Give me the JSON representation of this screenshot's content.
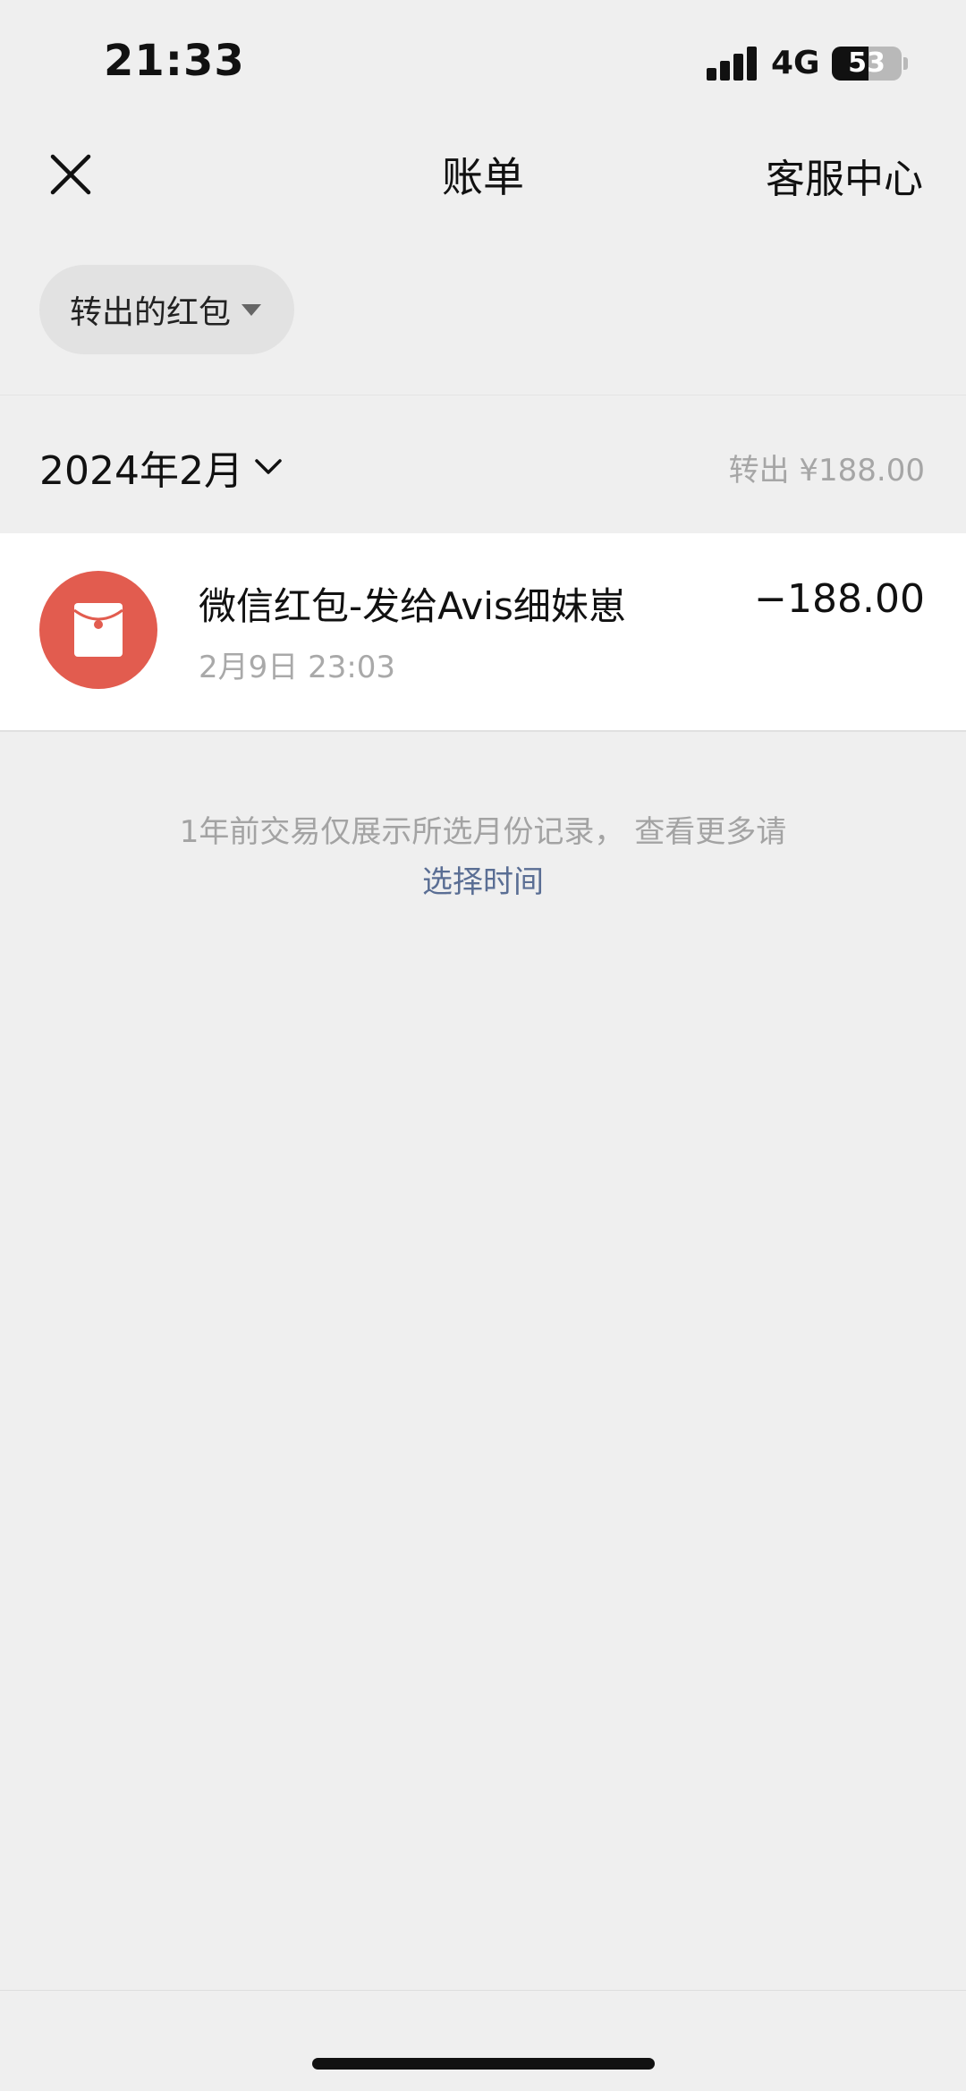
{
  "status_bar": {
    "time": "21:33",
    "network": "4G",
    "battery_percent": "53",
    "battery_level": 0.53
  },
  "nav": {
    "title": "账单",
    "service_center": "客服中心",
    "close_icon": "close-icon"
  },
  "filter": {
    "label": "转出的红包",
    "caret_icon": "caret-down-icon"
  },
  "month_section": {
    "month": "2024年2月",
    "summary": "转出 ¥188.00",
    "chevron_icon": "chevron-down-icon"
  },
  "transactions": [
    {
      "title": "微信红包-发给Avis细妹崽",
      "time": "2月9日 23:03",
      "amount": "−188.00",
      "icon": "red-envelope-icon",
      "icon_color": "#e25c4f"
    }
  ],
  "notice": {
    "text": "1年前交易仅展示所选月份记录， 查看更多请",
    "link": "选择时间",
    "link_color": "#5a6e94"
  }
}
